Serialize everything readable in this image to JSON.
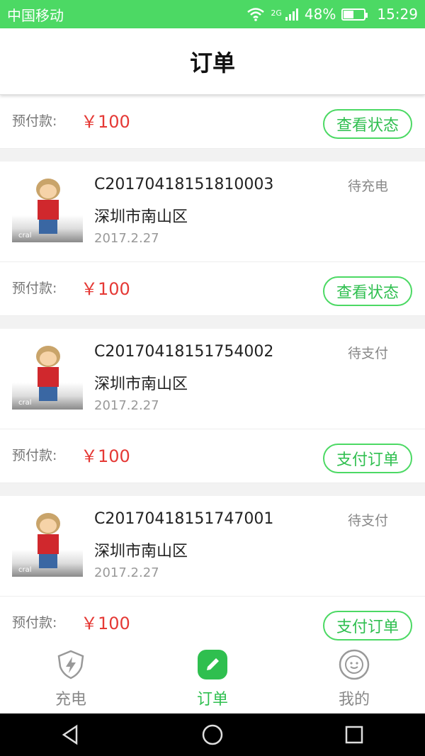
{
  "status_bar": {
    "carrier": "中国移动",
    "network": "2G",
    "battery_percent": "48%",
    "time": "15:29",
    "color": "#4cd964"
  },
  "header": {
    "title": "订单"
  },
  "orders_partial_top": {
    "pay_label": "预付款:",
    "amount": "￥100",
    "button_label": "查看状态"
  },
  "orders": [
    {
      "id": "C20170418151810003",
      "location": "深圳市南山区",
      "date": "2017.2.27",
      "status": "待充电",
      "pay_label": "预付款:",
      "amount": "￥100",
      "button_label": "查看状态",
      "thumb_text": "cral"
    },
    {
      "id": "C20170418151754002",
      "location": "深圳市南山区",
      "date": "2017.2.27",
      "status": "待支付",
      "pay_label": "预付款:",
      "amount": "￥100",
      "button_label": "支付订单",
      "thumb_text": "cral"
    },
    {
      "id": "C20170418151747001",
      "location": "深圳市南山区",
      "date": "2017.2.27",
      "status": "待支付",
      "pay_label": "预付款:",
      "amount": "￥100",
      "button_label": "支付订单",
      "thumb_text": "cral"
    }
  ],
  "bottom_nav": {
    "items": [
      {
        "label": "充电",
        "icon": "lightning-shield-icon",
        "active": false
      },
      {
        "label": "订单",
        "icon": "edit-pencil-icon",
        "active": true
      },
      {
        "label": "我的",
        "icon": "smiley-face-icon",
        "active": false
      }
    ]
  },
  "system_nav": {
    "back_icon": "back-triangle-icon",
    "home_icon": "home-circle-icon",
    "recents_icon": "recents-square-icon"
  },
  "colors": {
    "accent": "#4cd964",
    "price": "#e53935",
    "text": "#222222"
  }
}
